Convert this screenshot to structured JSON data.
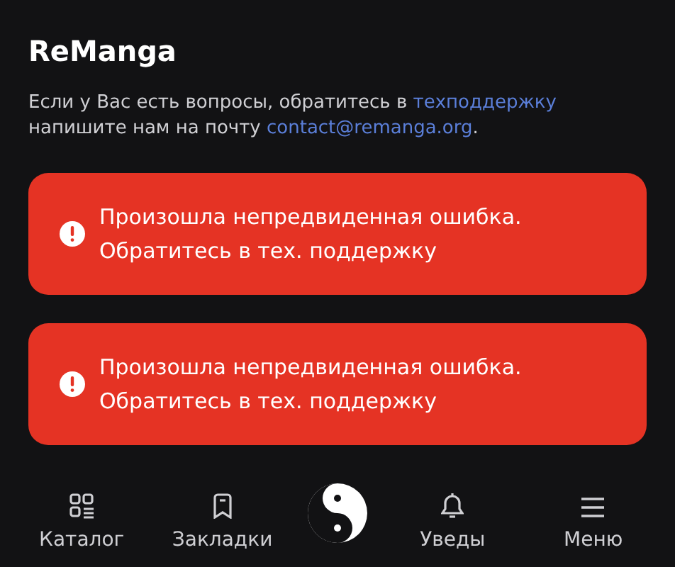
{
  "header": {
    "title": "ReManga"
  },
  "contact": {
    "text": "Если у Вас есть вопросы, обратитесь в ",
    "support_link": "техподдержку",
    "text_2": "напишите нам на почту ",
    "email_link": "contact@remanga.org",
    "text_3": "."
  },
  "toasts": [
    {
      "line_1": "Произошла непредвиденная ошибка.",
      "line_2": "Обратитесь в тех. поддержку"
    },
    {
      "line_1": "Произошла непредвиденная ошибка.",
      "line_2": "Обратитесь в тех. поддержку"
    }
  ],
  "bottom_nav": [
    {
      "kind": "catalog",
      "label": "Каталог"
    },
    {
      "kind": "bookmarks",
      "label": "Закладки"
    },
    {
      "kind": "logo"
    },
    {
      "kind": "notifications",
      "label": "Уведы"
    },
    {
      "kind": "menu",
      "label": "Меню"
    }
  ]
}
